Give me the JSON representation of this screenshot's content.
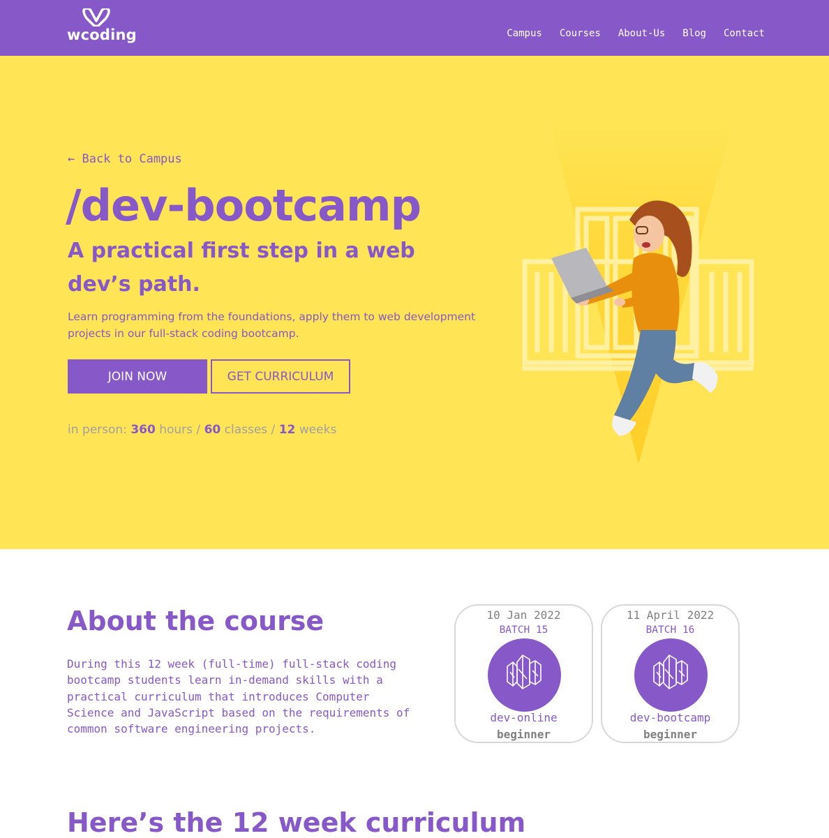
{
  "brand": {
    "name": "wcoding",
    "logo_icon": "heart-w-icon"
  },
  "nav": {
    "links": [
      "Campus",
      "Courses",
      "About-Us",
      "Blog",
      "Contact"
    ]
  },
  "hero": {
    "back_link": "← Back to Campus",
    "title": "/dev-bootcamp",
    "subtitle": "A practical first step in a web dev’s path.",
    "description": "Learn programming from the foundations, apply them to web development projects in our full-stack coding bootcamp.",
    "primary_button": "JOIN NOW",
    "secondary_button": "GET CURRICULUM",
    "stats": {
      "prefix": "in person:",
      "hours_value": "360",
      "hours_label": "hours /",
      "classes_value": "60",
      "classes_label": "classes /",
      "weeks_value": "12",
      "weeks_label": "weeks"
    },
    "image": "student-jumping-with-laptop"
  },
  "about": {
    "title": "About the course",
    "text": "During this 12 week (full-time) full-stack coding bootcamp students learn in-demand skills with a practical curriculum that introduces Computer Science and JavaScript based on the requirements of common software engineering projects."
  },
  "batches": [
    {
      "date": "10 Jan 2022",
      "batch": "BATCH 15",
      "course": "dev-online",
      "level": "beginner",
      "icon": "crystal-icon"
    },
    {
      "date": "11 April 2022",
      "batch": "BATCH 16",
      "course": "dev-bootcamp",
      "level": "beginner",
      "icon": "crystal-icon"
    }
  ],
  "curriculum": {
    "title": "Here’s the 12 week curriculum"
  },
  "colors": {
    "primary": "#8658c8",
    "hero_bg": "#ffe455",
    "muted": "#a1a0a0",
    "card_border": "#d8d8d8"
  }
}
